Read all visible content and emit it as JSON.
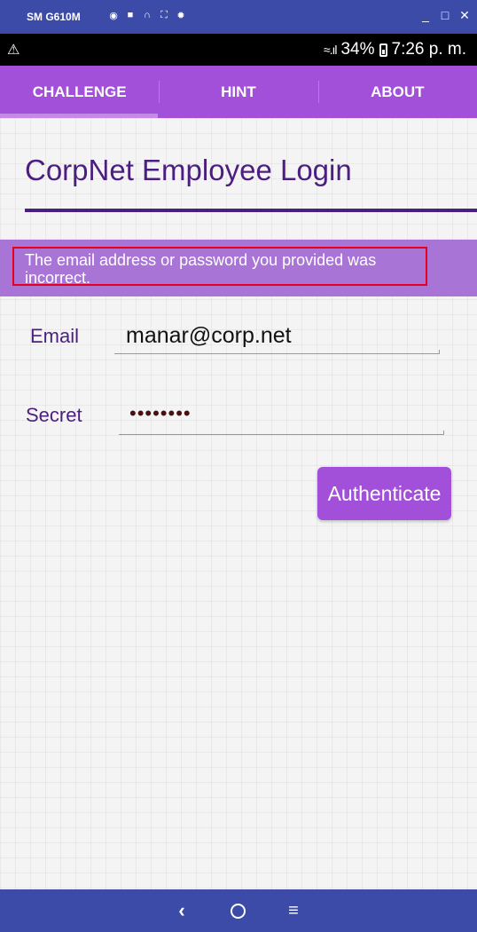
{
  "window": {
    "title": "SM G610M",
    "tools": [
      "camera-icon",
      "video-icon",
      "headset-icon",
      "fullscreen-icon",
      "settings-icon"
    ],
    "controls": [
      "minimize-icon",
      "maximize-icon",
      "close-icon"
    ]
  },
  "statusbar": {
    "battery": "34%",
    "time": "7:26 p. m."
  },
  "tabs": [
    {
      "label": "CHALLENGE",
      "active": true
    },
    {
      "label": "HINT",
      "active": false
    },
    {
      "label": "ABOUT",
      "active": false
    }
  ],
  "page": {
    "title": "CorpNet Employee Login",
    "error": "The email address or password you provided was incorrect."
  },
  "form": {
    "email_label": "Email",
    "email_value": "manar@corp.net",
    "secret_label": "Secret",
    "secret_value": "••••••••",
    "submit_label": "Authenticate"
  },
  "navbar": {
    "buttons": [
      "back-icon",
      "home-icon",
      "menu-icon"
    ]
  },
  "colors": {
    "accent": "#a24fd9",
    "title": "#4b1f7f",
    "error_banner": "#a875d6",
    "error_border": "#e8001c",
    "chrome": "#3c4aa8"
  }
}
